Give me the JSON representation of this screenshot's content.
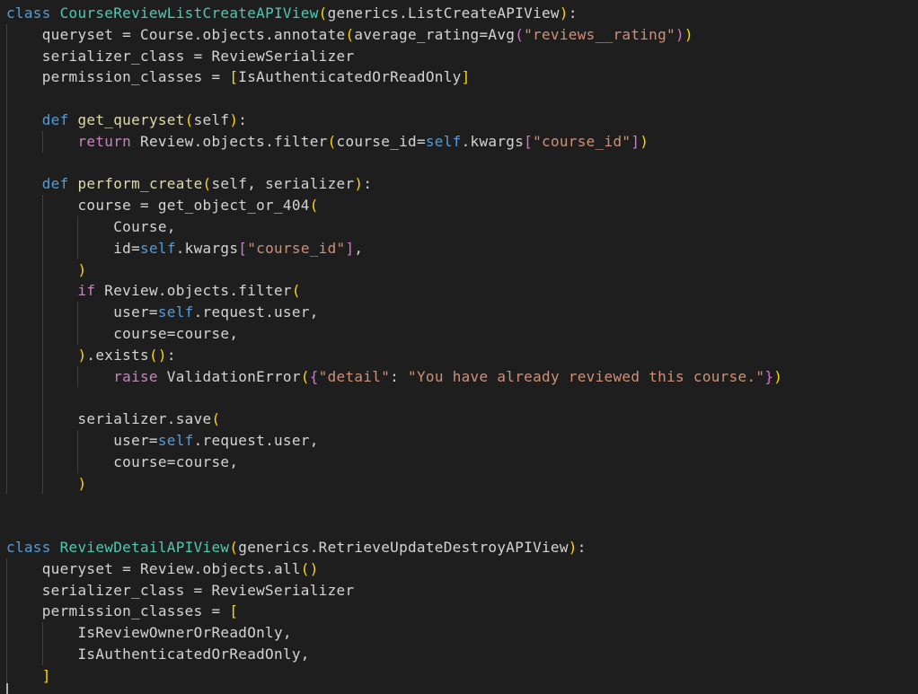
{
  "editor": {
    "language": "python",
    "colors": {
      "background": "#1e1e1e",
      "keyword": "#569cd6",
      "control_keyword": "#c586c0",
      "class_name": "#4ec9b0",
      "function": "#dcdcaa",
      "variable": "#9cdcfe",
      "string": "#ce9178",
      "bracket_level_1": "#ffd700",
      "bracket_level_2": "#da70d6",
      "bracket_level_3": "#179fff"
    },
    "lines": [
      {
        "indent": 0,
        "tokens": [
          [
            "kw",
            "class"
          ],
          [
            "op",
            " "
          ],
          [
            "cls",
            "CourseReviewListCreateAPIView"
          ],
          [
            "p1",
            "("
          ],
          [
            "op",
            "generics.ListCreateAPIView"
          ],
          [
            "p1",
            ")"
          ],
          [
            "op",
            ":"
          ]
        ]
      },
      {
        "indent": 1,
        "tokens": [
          [
            "op",
            "queryset = Course.objects.annotate"
          ],
          [
            "p1",
            "("
          ],
          [
            "op",
            "average_rating=Avg"
          ],
          [
            "p2",
            "("
          ],
          [
            "str",
            "\"reviews__rating\""
          ],
          [
            "p2",
            ")"
          ],
          [
            "p1",
            ")"
          ]
        ]
      },
      {
        "indent": 1,
        "tokens": [
          [
            "op",
            "serializer_class = ReviewSerializer"
          ]
        ]
      },
      {
        "indent": 1,
        "tokens": [
          [
            "op",
            "permission_classes = "
          ],
          [
            "p1",
            "["
          ],
          [
            "op",
            "IsAuthenticatedOrReadOnly"
          ],
          [
            "p1",
            "]"
          ]
        ]
      },
      {
        "indent": 1,
        "tokens": []
      },
      {
        "indent": 1,
        "tokens": [
          [
            "kw",
            "def"
          ],
          [
            "op",
            " "
          ],
          [
            "fn",
            "get_queryset"
          ],
          [
            "p1",
            "("
          ],
          [
            "op",
            "self"
          ],
          [
            "p1",
            ")"
          ],
          [
            "op",
            ":"
          ]
        ]
      },
      {
        "indent": 2,
        "tokens": [
          [
            "kw2",
            "return"
          ],
          [
            "op",
            " Review.objects.filter"
          ],
          [
            "p1",
            "("
          ],
          [
            "op",
            "course_id="
          ],
          [
            "kw",
            "self"
          ],
          [
            "op",
            ".kwargs"
          ],
          [
            "p2",
            "["
          ],
          [
            "str",
            "\"course_id\""
          ],
          [
            "p2",
            "]"
          ],
          [
            "p1",
            ")"
          ]
        ]
      },
      {
        "indent": 1,
        "tokens": []
      },
      {
        "indent": 1,
        "tokens": [
          [
            "kw",
            "def"
          ],
          [
            "op",
            " "
          ],
          [
            "fn",
            "perform_create"
          ],
          [
            "p1",
            "("
          ],
          [
            "op",
            "self, serializer"
          ],
          [
            "p1",
            ")"
          ],
          [
            "op",
            ":"
          ]
        ]
      },
      {
        "indent": 2,
        "tokens": [
          [
            "op",
            "course = get_object_or_404"
          ],
          [
            "p1",
            "("
          ]
        ]
      },
      {
        "indent": 3,
        "tokens": [
          [
            "op",
            "Course,"
          ]
        ]
      },
      {
        "indent": 3,
        "tokens": [
          [
            "op",
            "id="
          ],
          [
            "kw",
            "self"
          ],
          [
            "op",
            ".kwargs"
          ],
          [
            "p2",
            "["
          ],
          [
            "str",
            "\"course_id\""
          ],
          [
            "p2",
            "]"
          ],
          [
            "op",
            ","
          ]
        ]
      },
      {
        "indent": 2,
        "tokens": [
          [
            "p1",
            ")"
          ]
        ]
      },
      {
        "indent": 2,
        "tokens": [
          [
            "kw2",
            "if"
          ],
          [
            "op",
            " Review.objects.filter"
          ],
          [
            "p1",
            "("
          ]
        ]
      },
      {
        "indent": 3,
        "tokens": [
          [
            "op",
            "user="
          ],
          [
            "kw",
            "self"
          ],
          [
            "op",
            ".request.user,"
          ]
        ]
      },
      {
        "indent": 3,
        "tokens": [
          [
            "op",
            "course=course,"
          ]
        ]
      },
      {
        "indent": 2,
        "tokens": [
          [
            "p1",
            ")"
          ],
          [
            "op",
            ".exists"
          ],
          [
            "p1",
            "()"
          ],
          [
            "op",
            ":"
          ]
        ]
      },
      {
        "indent": 3,
        "tokens": [
          [
            "kw2",
            "raise"
          ],
          [
            "op",
            " ValidationError"
          ],
          [
            "p1",
            "("
          ],
          [
            "p2",
            "{"
          ],
          [
            "str",
            "\"detail\""
          ],
          [
            "op",
            ": "
          ],
          [
            "str",
            "\"You have already reviewed this course.\""
          ],
          [
            "p2",
            "}"
          ],
          [
            "p1",
            ")"
          ]
        ]
      },
      {
        "indent": 2,
        "tokens": []
      },
      {
        "indent": 2,
        "tokens": [
          [
            "op",
            "serializer.save"
          ],
          [
            "p1",
            "("
          ]
        ]
      },
      {
        "indent": 3,
        "tokens": [
          [
            "op",
            "user="
          ],
          [
            "kw",
            "self"
          ],
          [
            "op",
            ".request.user,"
          ]
        ]
      },
      {
        "indent": 3,
        "tokens": [
          [
            "op",
            "course=course,"
          ]
        ]
      },
      {
        "indent": 2,
        "tokens": [
          [
            "p1",
            ")"
          ]
        ]
      },
      {
        "indent": 0,
        "tokens": []
      },
      {
        "indent": 0,
        "tokens": []
      },
      {
        "indent": 0,
        "tokens": [
          [
            "kw",
            "class"
          ],
          [
            "op",
            " "
          ],
          [
            "cls",
            "ReviewDetailAPIView"
          ],
          [
            "p1",
            "("
          ],
          [
            "op",
            "generics.RetrieveUpdateDestroyAPIView"
          ],
          [
            "p1",
            ")"
          ],
          [
            "op",
            ":"
          ]
        ]
      },
      {
        "indent": 1,
        "tokens": [
          [
            "op",
            "queryset = Review.objects.all"
          ],
          [
            "p1",
            "()"
          ]
        ]
      },
      {
        "indent": 1,
        "tokens": [
          [
            "op",
            "serializer_class = ReviewSerializer"
          ]
        ]
      },
      {
        "indent": 1,
        "tokens": [
          [
            "op",
            "permission_classes = "
          ],
          [
            "p1",
            "["
          ]
        ]
      },
      {
        "indent": 2,
        "tokens": [
          [
            "op",
            "IsReviewOwnerOrReadOnly,"
          ]
        ]
      },
      {
        "indent": 2,
        "tokens": [
          [
            "op",
            "IsAuthenticatedOrReadOnly,"
          ]
        ]
      },
      {
        "indent": 1,
        "tokens": [
          [
            "p1",
            "]"
          ]
        ]
      }
    ]
  }
}
